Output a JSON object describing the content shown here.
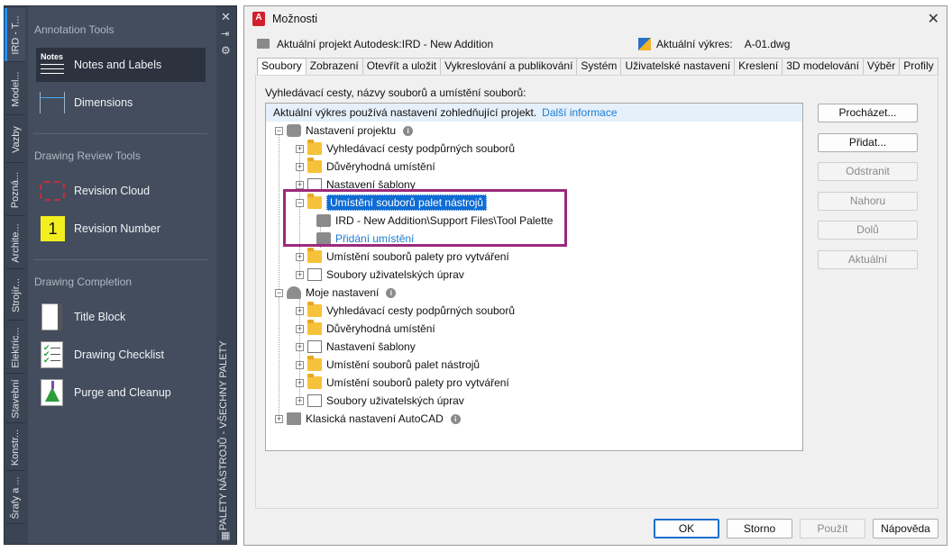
{
  "palette": {
    "vtabs": [
      "IRD - T...",
      "Model...",
      "Vazby",
      "Pozná...",
      "Archite...",
      "Strojír...",
      "Elektric...",
      "Stavební",
      "Konstr...",
      "Šrafy a ..."
    ],
    "sections": [
      "Annotation Tools",
      "Drawing Review Tools",
      "Drawing Completion"
    ],
    "items": [
      "Notes and Labels",
      "Dimensions",
      "Revision Cloud",
      "Revision Number",
      "Title Block",
      "Drawing Checklist",
      "Purge and Cleanup"
    ],
    "notes_icon_text": "Notes",
    "revision_number_icon_text": "1",
    "strip_title": "PALETY NÁSTROJŮ - VŠECHNY PALETY",
    "close_glyph": "✕",
    "accent": "#1e90ff"
  },
  "dialog": {
    "title": "Možnosti",
    "app_icon_text": "A",
    "close_glyph": "✕",
    "project_label": "Aktuální projekt Autodesk:IRD - New Addition",
    "drawing_label": "Aktuální výkres:",
    "drawing_value": "A-01.dwg",
    "tabs": [
      "Soubory",
      "Zobrazení",
      "Otevřít a uložit",
      "Vykreslování a publikování",
      "Systém",
      "Uživatelské nastavení",
      "Kreslení",
      "3D modelování",
      "Výběr",
      "Profily"
    ],
    "active_tab": "Soubory",
    "panel_label": "Vyhledávací cesty, názvy souborů a umístění souborů:",
    "tree": {
      "notice": "Aktuální výkres používá nastavení zohledňující projekt.",
      "notice_link": "Další informace",
      "project_settings": "Nastavení projektu",
      "project_children": [
        "Vyhledávací cesty podpůrných souborů",
        "Důvěryhodná umístění",
        "Nastavení šablony",
        "Umístění souborů palet nástrojů"
      ],
      "tool_palette_path": "IRD - New Addition\\Support Files\\Tool Palette",
      "add_location": "Přidání umístění",
      "project_children_after": [
        "Umístění souborů palety pro vytváření",
        "Soubory uživatelských úprav"
      ],
      "my_settings": "Moje nastavení",
      "my_children": [
        "Vyhledávací cesty podpůrných souborů",
        "Důvěryhodná umístění",
        "Nastavení šablony",
        "Umístění souborů palet nástrojů",
        "Umístění souborů palety pro vytváření",
        "Soubory uživatelských úprav"
      ],
      "classic": "Klasická nastavení AutoCAD"
    },
    "side_buttons": [
      "Procházet...",
      "Přidat...",
      "Odstranit",
      "Nahoru",
      "Dolů",
      "Aktuální"
    ],
    "bottom_buttons": [
      "OK",
      "Storno",
      "Použít",
      "Nápověda"
    ],
    "highlight_color": "#9b2a7c"
  }
}
